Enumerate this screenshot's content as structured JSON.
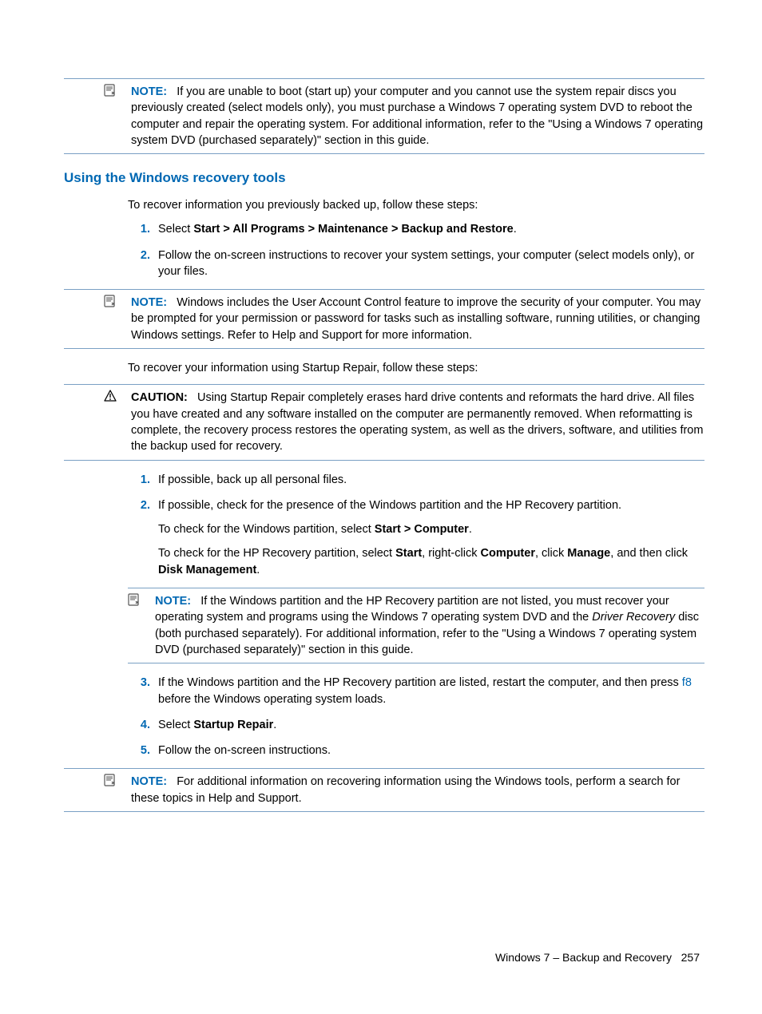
{
  "notes": {
    "top": {
      "label": "NOTE:",
      "text": "If you are unable to boot (start up) your computer and you cannot use the system repair discs you previously created (select models only), you must purchase a Windows 7 operating system DVD to reboot the computer and repair the operating system. For additional information, refer to the \"Using a Windows 7 operating system DVD (purchased separately)\" section in this guide."
    },
    "uac": {
      "label": "NOTE:",
      "text": "Windows includes the User Account Control feature to improve the security of your computer. You may be prompted for your permission or password for tasks such as installing software, running utilities, or changing Windows settings. Refer to Help and Support for more information."
    },
    "partition": {
      "label": "NOTE:",
      "text_a": "If the Windows partition and the HP Recovery partition are not listed, you must recover your operating system and programs using the Windows 7 operating system DVD and the ",
      "italic": "Driver Recovery",
      "text_b": " disc (both purchased separately). For additional information, refer to the \"Using a Windows 7 operating system DVD (purchased separately)\" section in this guide."
    },
    "bottom": {
      "label": "NOTE:",
      "text": "For additional information on recovering information using the Windows tools, perform a search for these topics in Help and Support."
    }
  },
  "caution": {
    "label": "CAUTION:",
    "text": "Using Startup Repair completely erases hard drive contents and reformats the hard drive. All files you have created and any software installed on the computer are permanently removed. When reformatting is complete, the recovery process restores the operating system, as well as the drivers, software, and utilities from the backup used for recovery."
  },
  "heading": "Using the Windows recovery tools",
  "intro1": "To recover information you previously backed up, follow these steps:",
  "steps1": {
    "s1_a": "Select ",
    "s1_bold": "Start > All Programs > Maintenance > Backup and Restore",
    "s1_b": ".",
    "s2": "Follow the on-screen instructions to recover your system settings, your computer (select models only), or your files."
  },
  "intro2": "To recover your information using Startup Repair, follow these steps:",
  "steps2": {
    "s1": "If possible, back up all personal files.",
    "s2": "If possible, check for the presence of the Windows partition and the HP Recovery partition.",
    "s2_sub1_a": "To check for the Windows partition, select ",
    "s2_sub1_bold": "Start > Computer",
    "s2_sub1_b": ".",
    "s2_sub2_a": "To check for the HP Recovery partition, select ",
    "s2_sub2_bold1": "Start",
    "s2_sub2_b": ", right-click ",
    "s2_sub2_bold2": "Computer",
    "s2_sub2_c": ", click ",
    "s2_sub2_bold3": "Manage",
    "s2_sub2_d": ", and then click ",
    "s2_sub2_bold4": "Disk Management",
    "s2_sub2_e": ".",
    "s3_a": "If the Windows partition and the HP Recovery partition are listed, restart the computer, and then press ",
    "s3_key": "f8",
    "s3_b": " before the Windows operating system loads.",
    "s4_a": "Select ",
    "s4_bold": "Startup Repair",
    "s4_b": ".",
    "s5": "Follow the on-screen instructions."
  },
  "footer": {
    "chapter": "Windows 7 – Backup and Recovery",
    "page": "257"
  }
}
